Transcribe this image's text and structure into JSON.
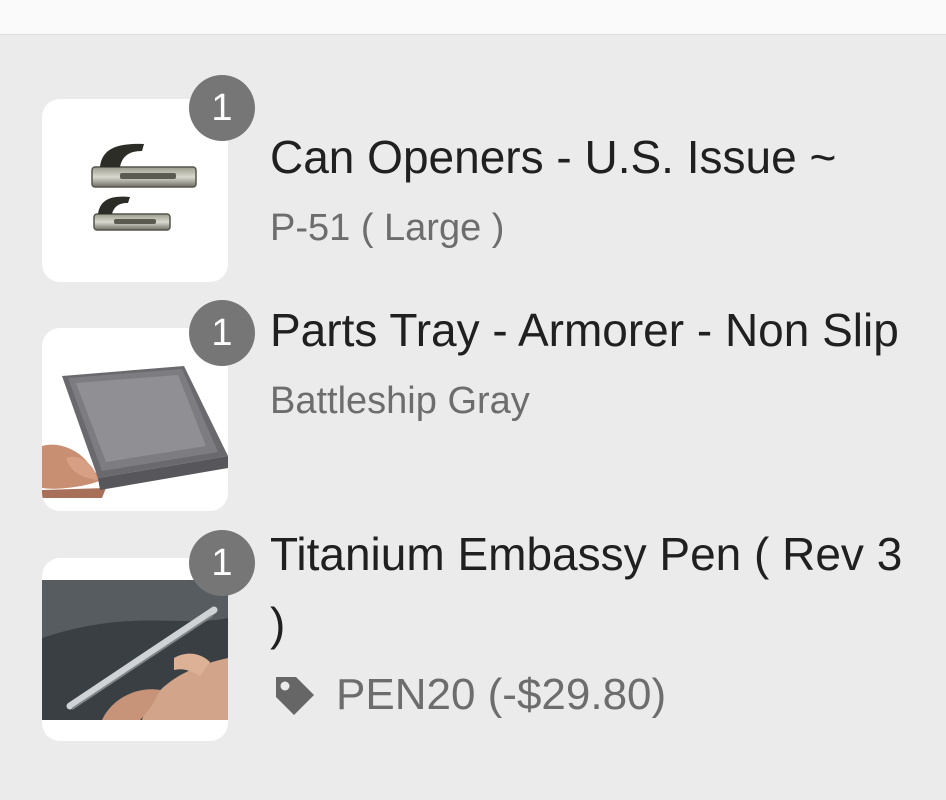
{
  "cart": {
    "items": [
      {
        "quantity": "1",
        "title": "Can Openers - U.S. Issue ~",
        "variant": "P-51 ( Large )",
        "image_icon": "can-opener-icon"
      },
      {
        "quantity": "1",
        "title": "Parts Tray - Armorer - Non Slip",
        "variant": "Battleship Gray",
        "image_icon": "parts-tray-icon"
      },
      {
        "quantity": "1",
        "title": "Titanium Embassy Pen ( Rev 3 )",
        "discount": "PEN20 (-$29.80)",
        "discount_icon": "tag-icon",
        "image_icon": "pen-icon"
      }
    ]
  },
  "colors": {
    "background": "#ebebeb",
    "badge": "#767676",
    "title": "#202020",
    "secondary": "#6d6d6d"
  }
}
